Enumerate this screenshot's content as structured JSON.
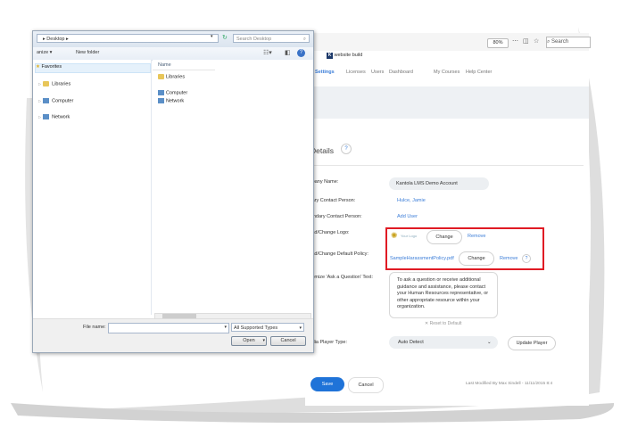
{
  "browser": {
    "zoom": "80%",
    "search_placeholder": "Search",
    "tab_title": "website build",
    "tab_icon_letter": "K",
    "nav": [
      "any Settings",
      "Licenses",
      "Users",
      "Dashboard",
      "My Courses",
      "Help Center"
    ],
    "heading": "Details",
    "help_glyph": "?",
    "fields": {
      "company_name_label": "ompany Name:",
      "company_name_value": "Kantola LMS Demo Account",
      "primary_contact_label": "rimary Contact Person:",
      "primary_contact_value": "Hulce, Jamie",
      "secondary_contact_label": "econdary Contact Person:",
      "secondary_contact_value": "Add User",
      "logo_label": "pload/Change Logo:",
      "logo_caption": "Your Logo",
      "logo_change": "Change",
      "logo_remove": "Remove",
      "policy_label": "pload/Change Default Policy:",
      "policy_file": "SampleHarassmentPolicy.pdf",
      "policy_change": "Change",
      "policy_remove": "Remove",
      "ask_label": "ustomize 'Ask a Question' Text:",
      "ask_text": "To ask a question or receive additional guidance and assistance, please contact your Human Resources representative, or other appropriate resource within your organization.",
      "reset": "✕ Reset to Default",
      "media_label": "Media Player Type:",
      "media_value": "Auto Detect",
      "update_player": "Update Player"
    },
    "save": "Save",
    "cancel": "Cancel",
    "modified": "Last Modified By Max Sindell - 11/11/2015 8:4"
  },
  "dialog": {
    "breadcrumb": "▸ Desktop ▸",
    "search_placeholder": "Search Desktop",
    "organize": "anize ▾",
    "new_folder": "New folder",
    "tree": [
      "Favorites",
      "Libraries",
      "Computer",
      "Network"
    ],
    "column_header": "Name",
    "files": [
      "Libraries",
      "Computer",
      "Network"
    ],
    "file_name_label": "File name:",
    "file_name_value": "",
    "filter": "All Supported Types",
    "open": "Open",
    "cancel": "Cancel"
  },
  "colors": {
    "accent": "#1f73d8",
    "highlight_box": "#e01b24",
    "link": "#3b7dd8"
  }
}
